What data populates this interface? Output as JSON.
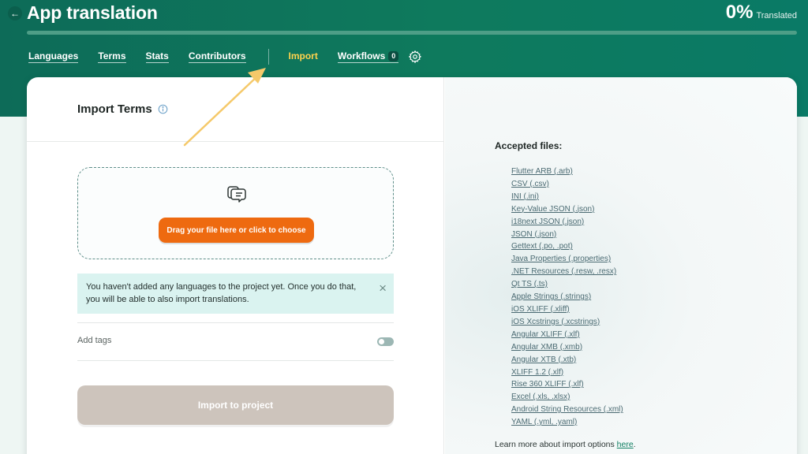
{
  "header": {
    "back_glyph": "←",
    "title": "App translation",
    "percent": "0%",
    "percent_label": "Translated",
    "progress_fraction": 0.0
  },
  "nav": {
    "items": [
      {
        "label": "Languages",
        "active": false
      },
      {
        "label": "Terms",
        "active": false
      },
      {
        "label": "Stats",
        "active": false
      },
      {
        "label": "Contributors",
        "active": false
      },
      {
        "label": "Import",
        "active": true
      },
      {
        "label": "Workflows",
        "active": false,
        "badge": "0"
      }
    ],
    "settings_icon": "gear-icon"
  },
  "import_panel": {
    "title": "Import Terms",
    "info_icon": "info-icon",
    "dropzone_icon": "document-chat-icon",
    "choose_label": "Drag your file here or click to choose",
    "notice": "You haven't added any languages to the project yet. Once you do that, you will be able to also import translations.",
    "notice_close": "×",
    "add_tags_label": "Add tags",
    "add_tags_enabled": false,
    "import_button": "Import to project"
  },
  "accepted": {
    "title": "Accepted files:",
    "files": [
      "Flutter ARB (.arb)",
      "CSV (.csv)",
      "INI (.ini)",
      "Key-Value JSON (.json)",
      "i18next JSON (.json)",
      "JSON (.json)",
      "Gettext (.po, .pot)",
      "Java Properties (.properties)",
      ".NET Resources (.resw, .resx)",
      "Qt TS (.ts)",
      "Apple Strings (.strings)",
      "iOS XLIFF (.xliff)",
      "iOS Xcstrings (.xcstrings)",
      "Angular XLIFF (.xlf)",
      "Angular XMB (.xmb)",
      "Angular XTB (.xtb)",
      "XLIFF 1.2 (.xlf)",
      "Rise 360 XLIFF (.xlf)",
      "Excel (.xls, .xlsx)",
      "Android String Resources (.xml)",
      "YAML (.yml, .yaml)"
    ],
    "learn_more_prefix": "Learn more about import options ",
    "learn_more_link": "here",
    "learn_more_suffix": "."
  },
  "colors": {
    "header_green": "#0e7a5d",
    "active_nav": "#ffd34d",
    "accent_orange": "#ee6a10",
    "disabled_button": "#cdc4bc",
    "annotation_arrow": "#f5c96a"
  }
}
